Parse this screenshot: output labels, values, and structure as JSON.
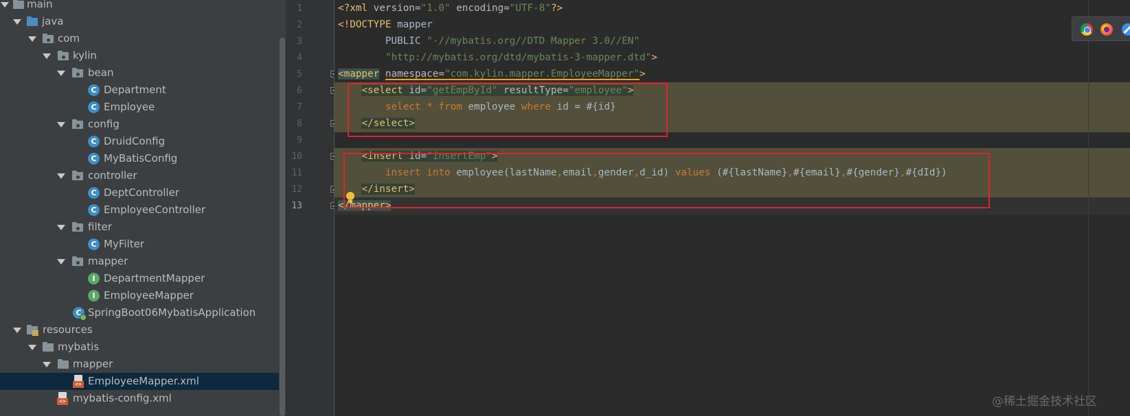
{
  "project_tree": {
    "items": [
      {
        "label": "main",
        "kind": "folder"
      },
      {
        "label": "java",
        "kind": "source-folder"
      },
      {
        "label": "com",
        "kind": "package"
      },
      {
        "label": "kylin",
        "kind": "package"
      },
      {
        "label": "bean",
        "kind": "package"
      },
      {
        "label": "Department",
        "kind": "class"
      },
      {
        "label": "Employee",
        "kind": "class"
      },
      {
        "label": "config",
        "kind": "package"
      },
      {
        "label": "DruidConfig",
        "kind": "class"
      },
      {
        "label": "MyBatisConfig",
        "kind": "class"
      },
      {
        "label": "controller",
        "kind": "package"
      },
      {
        "label": "DeptController",
        "kind": "class"
      },
      {
        "label": "EmployeeController",
        "kind": "class"
      },
      {
        "label": "filter",
        "kind": "package"
      },
      {
        "label": "MyFilter",
        "kind": "class"
      },
      {
        "label": "mapper",
        "kind": "package"
      },
      {
        "label": "DepartmentMapper",
        "kind": "interface"
      },
      {
        "label": "EmployeeMapper",
        "kind": "interface"
      },
      {
        "label": "SpringBoot06MybatisApplication",
        "kind": "spring-boot-class"
      },
      {
        "label": "resources",
        "kind": "resources-folder"
      },
      {
        "label": "mybatis",
        "kind": "folder"
      },
      {
        "label": "mapper",
        "kind": "folder"
      },
      {
        "label": "EmployeeMapper.xml",
        "kind": "xml-file",
        "selected": true
      },
      {
        "label": "mybatis-config.xml",
        "kind": "xml-file"
      }
    ],
    "icon_letters": {
      "class": "C",
      "interface": "I"
    }
  },
  "editor": {
    "line_numbers": [
      "1",
      "2",
      "3",
      "4",
      "5",
      "6",
      "7",
      "8",
      "9",
      "10",
      "11",
      "12",
      "13"
    ],
    "current_line": "13",
    "code": {
      "l1": {
        "a": "<?xml ",
        "b": "version",
        "c": "=",
        "d": "\"1.0\"",
        "e": " ",
        "f": "encoding",
        "g": "=",
        "h": "\"UTF-8\"",
        "i": "?>"
      },
      "l2": {
        "a": "<!DOCTYPE ",
        "b": "mapper"
      },
      "l3": {
        "a": "        PUBLIC ",
        "b": "\"-//mybatis.org//DTD Mapper 3.0//EN\""
      },
      "l4": {
        "a": "        ",
        "b": "\"http://mybatis.org/dtd/mybatis-3-mapper.dtd\"",
        "c": ">"
      },
      "l5": {
        "a": "<mapper",
        "b": " ",
        "c": "namespace",
        "d": "=",
        "e": "\"com.kylin.mapper.EmployeeMapper\"",
        "f": ">"
      },
      "l6": {
        "a": "    ",
        "b": "<select ",
        "c": "id",
        "d": "=",
        "e": "\"getEmpById\"",
        "f": " ",
        "g": "resultType",
        "h": "=",
        "i": "\"employee\"",
        "j": ">"
      },
      "l7": {
        "a": "        ",
        "b": "select",
        "c": " ",
        "d": "*",
        "e": " ",
        "f": "from",
        "g": " employee ",
        "h": "where",
        "i": " id = #{id}"
      },
      "l8": {
        "a": "    ",
        "b": "</select>"
      },
      "l10": {
        "a": "    ",
        "b": "<insert ",
        "c": "id",
        "d": "=",
        "e": "\"insertEmp\"",
        "f": ">"
      },
      "l11": {
        "a": "        ",
        "b": "insert",
        "c": " ",
        "d": "into",
        "e": " employee(lastName",
        "f": ",",
        "g": "email",
        "h": ",",
        "i": "gender",
        "j": ",",
        "k": "d_id) ",
        "l": "values",
        "m": " (#{lastName}",
        "n": ",",
        "o": "#{email}",
        "p": ",",
        "q": "#{gender}",
        "r": ",",
        "s": "#{dId})"
      },
      "l12": {
        "a": "    ",
        "b": "</insert>"
      },
      "l13": {
        "a": "</mapper>"
      }
    }
  },
  "colors": {
    "xml_tag": "#e8bf6a",
    "xml_string": "#6a8759",
    "sql_keyword": "#cc7832",
    "highlight_band": "#52503a",
    "annotation_box": "#e2222a"
  },
  "browser_icons": [
    "chrome-icon",
    "firefox-icon",
    "safari-icon"
  ],
  "watermark": "@稀土掘金技术社区"
}
